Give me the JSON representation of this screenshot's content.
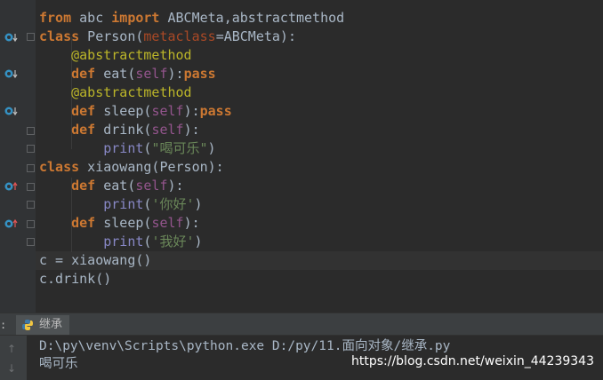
{
  "editor": {
    "lines": [
      {
        "parts": [
          [
            "kw",
            "from"
          ],
          [
            "plain",
            " "
          ],
          [
            "plain",
            "abc"
          ],
          [
            "plain",
            " "
          ],
          [
            "kw",
            "import"
          ],
          [
            "plain",
            " ABCMeta,abstractmethod"
          ]
        ]
      },
      {
        "parts": [
          [
            "kw",
            "class"
          ],
          [
            "plain",
            " Person("
          ],
          [
            "param",
            "metaclass"
          ],
          [
            "plain",
            "=ABCMeta):"
          ]
        ]
      },
      {
        "parts": [
          [
            "plain",
            "    "
          ],
          [
            "dec",
            "@abstractmethod"
          ]
        ]
      },
      {
        "parts": [
          [
            "plain",
            "    "
          ],
          [
            "kw",
            "def"
          ],
          [
            "plain",
            " eat("
          ],
          [
            "self",
            "self"
          ],
          [
            "plain",
            "):"
          ],
          [
            "kw",
            "pass"
          ]
        ]
      },
      {
        "parts": [
          [
            "plain",
            "    "
          ],
          [
            "dec",
            "@abstractmethod"
          ]
        ]
      },
      {
        "parts": [
          [
            "plain",
            "    "
          ],
          [
            "kw",
            "def"
          ],
          [
            "plain",
            " sleep("
          ],
          [
            "self",
            "self"
          ],
          [
            "plain",
            "):"
          ],
          [
            "kw",
            "pass"
          ]
        ]
      },
      {
        "parts": [
          [
            "plain",
            "    "
          ],
          [
            "kw",
            "def"
          ],
          [
            "plain",
            " drink("
          ],
          [
            "self",
            "self"
          ],
          [
            "plain",
            "):"
          ]
        ]
      },
      {
        "parts": [
          [
            "plain",
            "        "
          ],
          [
            "bltin",
            "print"
          ],
          [
            "plain",
            "("
          ],
          [
            "str",
            "\"喝可乐\""
          ],
          [
            "plain",
            ")"
          ]
        ]
      },
      {
        "parts": [
          [
            "kw",
            "class"
          ],
          [
            "plain",
            " xiaowang(Person):"
          ]
        ]
      },
      {
        "parts": [
          [
            "plain",
            "    "
          ],
          [
            "kw",
            "def"
          ],
          [
            "plain",
            " eat("
          ],
          [
            "self",
            "self"
          ],
          [
            "plain",
            "):"
          ]
        ]
      },
      {
        "parts": [
          [
            "plain",
            "        "
          ],
          [
            "bltin",
            "print"
          ],
          [
            "plain",
            "("
          ],
          [
            "str",
            "'你好'"
          ],
          [
            "plain",
            ")"
          ]
        ]
      },
      {
        "parts": [
          [
            "plain",
            "    "
          ],
          [
            "kw",
            "def"
          ],
          [
            "plain",
            " sleep("
          ],
          [
            "self",
            "self"
          ],
          [
            "plain",
            "):"
          ]
        ]
      },
      {
        "parts": [
          [
            "plain",
            "        "
          ],
          [
            "bltin",
            "print"
          ],
          [
            "plain",
            "("
          ],
          [
            "str",
            "'我好'"
          ],
          [
            "plain",
            ")"
          ]
        ]
      },
      {
        "parts": [
          [
            "plain",
            "c = xiaowang()"
          ]
        ]
      },
      {
        "parts": [
          [
            "plain",
            "c.drink()"
          ]
        ]
      }
    ]
  },
  "run_panel": {
    "tab_label": "继承",
    "command": "D:\\py\\venv\\Scripts\\python.exe D:/py/11.面向对象/继承.py",
    "output": "喝可乐"
  },
  "watermark": "https://blog.csdn.net/weixin_44239343",
  "colors": {
    "keyword": "#cc7832",
    "decorator": "#bbb529",
    "self": "#94558d",
    "string": "#6a8759",
    "text": "#a9b7c6",
    "background": "#2b2b2b"
  }
}
